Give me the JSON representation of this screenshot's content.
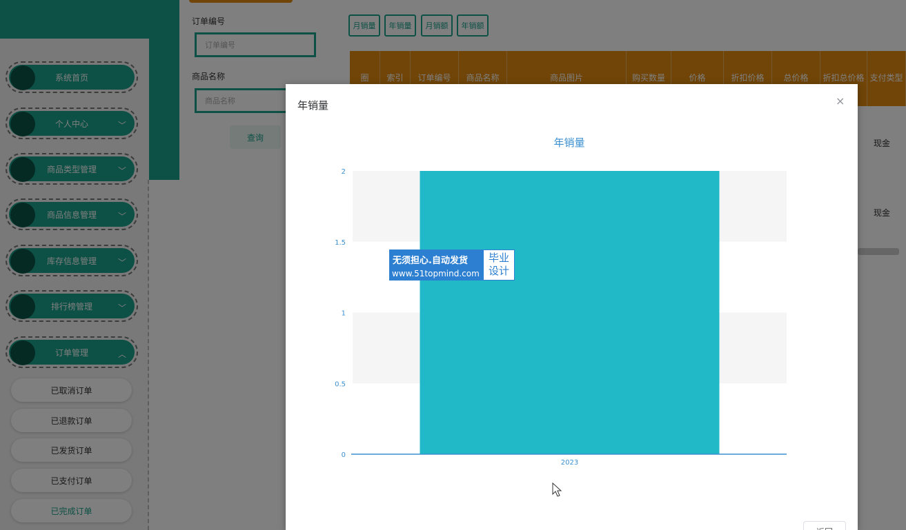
{
  "sidebar": {
    "menu": [
      {
        "label": "系统首页",
        "chevron": ""
      },
      {
        "label": "个人中心",
        "chevron": "﹀"
      },
      {
        "label": "商品类型管理",
        "chevron": "﹀"
      },
      {
        "label": "商品信息管理",
        "chevron": "﹀"
      },
      {
        "label": "库存信息管理",
        "chevron": "﹀"
      },
      {
        "label": "排行榜管理",
        "chevron": "﹀"
      },
      {
        "label": "订单管理",
        "chevron": "︿"
      }
    ],
    "submenu": [
      "已取消订单",
      "已退款订单",
      "已发货订单",
      "已支付订单",
      "已完成订单"
    ]
  },
  "search": {
    "order_label": "订单编号",
    "order_placeholder": "订单编号",
    "product_label": "商品名称",
    "product_placeholder": "商品名称",
    "query_button": "查询"
  },
  "toolbar": {
    "buttons": [
      "月销量",
      "年销量",
      "月销额",
      "年销额"
    ]
  },
  "table": {
    "headers": [
      "圈",
      "索引",
      "订单编号",
      "商品名称",
      "商品图片",
      "购买数量",
      "价格",
      "折扣价格",
      "总价格",
      "折扣总价格",
      "支付类型"
    ],
    "pay_type_rows": [
      "现金",
      "现金"
    ]
  },
  "modal": {
    "title": "年销量",
    "close_icon": "×",
    "return_button": "返回"
  },
  "chart_data": {
    "type": "bar",
    "title": "年销量",
    "categories": [
      "2023"
    ],
    "values": [
      2
    ],
    "ylim": [
      0,
      2
    ],
    "yticks": [
      0,
      0.5,
      1,
      1.5,
      2
    ],
    "xlabel": "",
    "ylabel": "",
    "grid": true,
    "colors": {
      "bar": "#21b8c8",
      "axis": "#3a8fd0",
      "title": "#3a8fd0",
      "band": "#f5f5f5"
    }
  },
  "watermark": {
    "line1": "无须担心.自动发货",
    "line2": "www.51topmind.com",
    "right": "毕业设计"
  },
  "colors": {
    "teal": "#1aa08a",
    "orange": "#e08a0e"
  }
}
